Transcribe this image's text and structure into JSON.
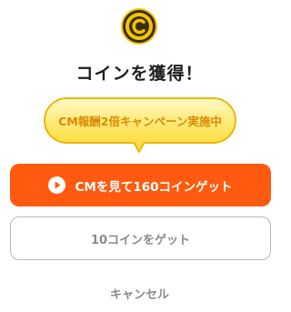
{
  "dialog": {
    "icon": "coin-icon",
    "title": "コインを獲得！",
    "promo_bubble": "CM報酬2倍キャンペーン実施中",
    "primary_button": {
      "icon": "play-icon",
      "label": "CMを見て160コインゲット"
    },
    "secondary_button": {
      "label": "10コインをゲット"
    },
    "cancel_label": "キャンセル"
  },
  "colors": {
    "accent": "#ff5a0f",
    "coin_gold": "#f4c20d",
    "bubble_text": "#d98a00",
    "muted_text": "#8a8a8a"
  }
}
